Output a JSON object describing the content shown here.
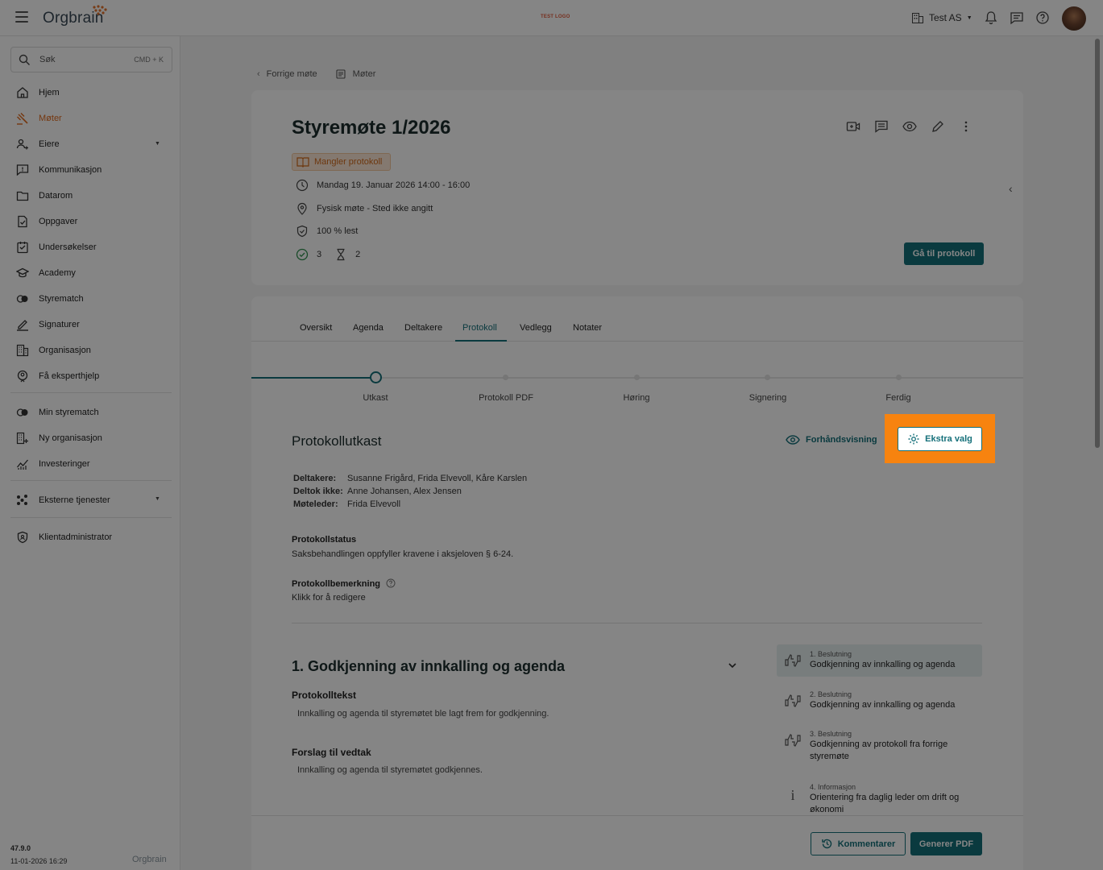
{
  "topbar": {
    "logo_text": "Orgbrain",
    "test_logo": "TEST LOGO",
    "org_name": "Test AS"
  },
  "sidebar": {
    "search_placeholder": "Søk",
    "search_shortcut": "CMD + K",
    "items": [
      {
        "label": "Hjem",
        "icon": "home-icon"
      },
      {
        "label": "Møter",
        "icon": "gavel-icon",
        "active": true
      },
      {
        "label": "Eiere",
        "icon": "owners-icon"
      },
      {
        "label": "Kommunikasjon",
        "icon": "chat-icon"
      },
      {
        "label": "Datarom",
        "icon": "folder-icon"
      },
      {
        "label": "Oppgaver",
        "icon": "task-icon"
      },
      {
        "label": "Undersøkelser",
        "icon": "survey-icon"
      },
      {
        "label": "Academy",
        "icon": "academy-icon"
      },
      {
        "label": "Styrematch",
        "icon": "match-icon"
      },
      {
        "label": "Signaturer",
        "icon": "signature-icon"
      },
      {
        "label": "Organisasjon",
        "icon": "building-icon"
      },
      {
        "label": "Få eksperthjelp",
        "icon": "expert-icon"
      }
    ],
    "items2": [
      {
        "label": "Min styrematch",
        "icon": "match-icon"
      },
      {
        "label": "Ny organisasjon",
        "icon": "building-add-icon"
      },
      {
        "label": "Investeringer",
        "icon": "chart-icon"
      }
    ],
    "external": "Eksterne tjenester",
    "admin": "Klientadministrator",
    "version": "47.9.0",
    "build_date": "11-01-2026 16:29",
    "footer_logo": "Orgbrain"
  },
  "breadcrumb": {
    "back": "Forrige møte",
    "current": "Møter"
  },
  "meeting": {
    "title": "Styremøte 1/2026",
    "status": "Mangler protokoll",
    "datetime": "Mandag 19. Januar 2026 14:00 - 16:00",
    "location": "Fysisk møte - Sted ikke angitt",
    "read": "100 % lest",
    "approved_count": "3",
    "pending_count": "2",
    "goto_protocol": "Gå til protokoll"
  },
  "tabs": [
    "Oversikt",
    "Agenda",
    "Deltakere",
    "Protokoll",
    "Vedlegg",
    "Notater"
  ],
  "steps": [
    "Utkast",
    "Protokoll PDF",
    "Høring",
    "Signering",
    "Ferdig"
  ],
  "protocol": {
    "heading": "Protokollutkast",
    "preview": "Forhåndsvisning",
    "extra": "Ekstra valg",
    "participants_label": "Deltakere:",
    "participants": "Susanne Frigård, Frida Elvevoll, Kåre Karslen",
    "absent_label": "Deltok ikke:",
    "absent": "Anne Johansen, Alex Jensen",
    "leader_label": "Møteleder:",
    "leader": "Frida Elvevoll",
    "status_label": "Protokollstatus",
    "status_text": "Saksbehandlingen oppfyller kravene i aksjeloven § 6-24.",
    "remark_label": "Protokollbemerkning",
    "remark_text": "Klikk for å redigere"
  },
  "item": {
    "title": "1. Godkjenning av innkalling og agenda",
    "protocol_text_label": "Protokolltekst",
    "protocol_text": "Innkalling og agenda til styremøtet ble lagt frem for godkjenning.",
    "proposal_label": "Forslag til vedtak",
    "proposal": "Innkalling og agenda til styremøtet godkjennes."
  },
  "agenda_list": [
    {
      "type": "1. Beslutning",
      "name": "Godkjenning av innkalling og agenda"
    },
    {
      "type": "2. Beslutning",
      "name": "Godkjenning av innkalling og agenda"
    },
    {
      "type": "3. Beslutning",
      "name": "Godkjenning av protokoll fra forrige styremøte"
    },
    {
      "type": "4. Informasjon",
      "name": "Orientering fra daglig leder om drift og økonomi"
    }
  ],
  "footer": {
    "comments": "Kommentarer",
    "generate": "Generer PDF"
  },
  "colors": {
    "primary": "#15707a",
    "accent": "#e06a1e",
    "highlight": "#f7830f"
  }
}
